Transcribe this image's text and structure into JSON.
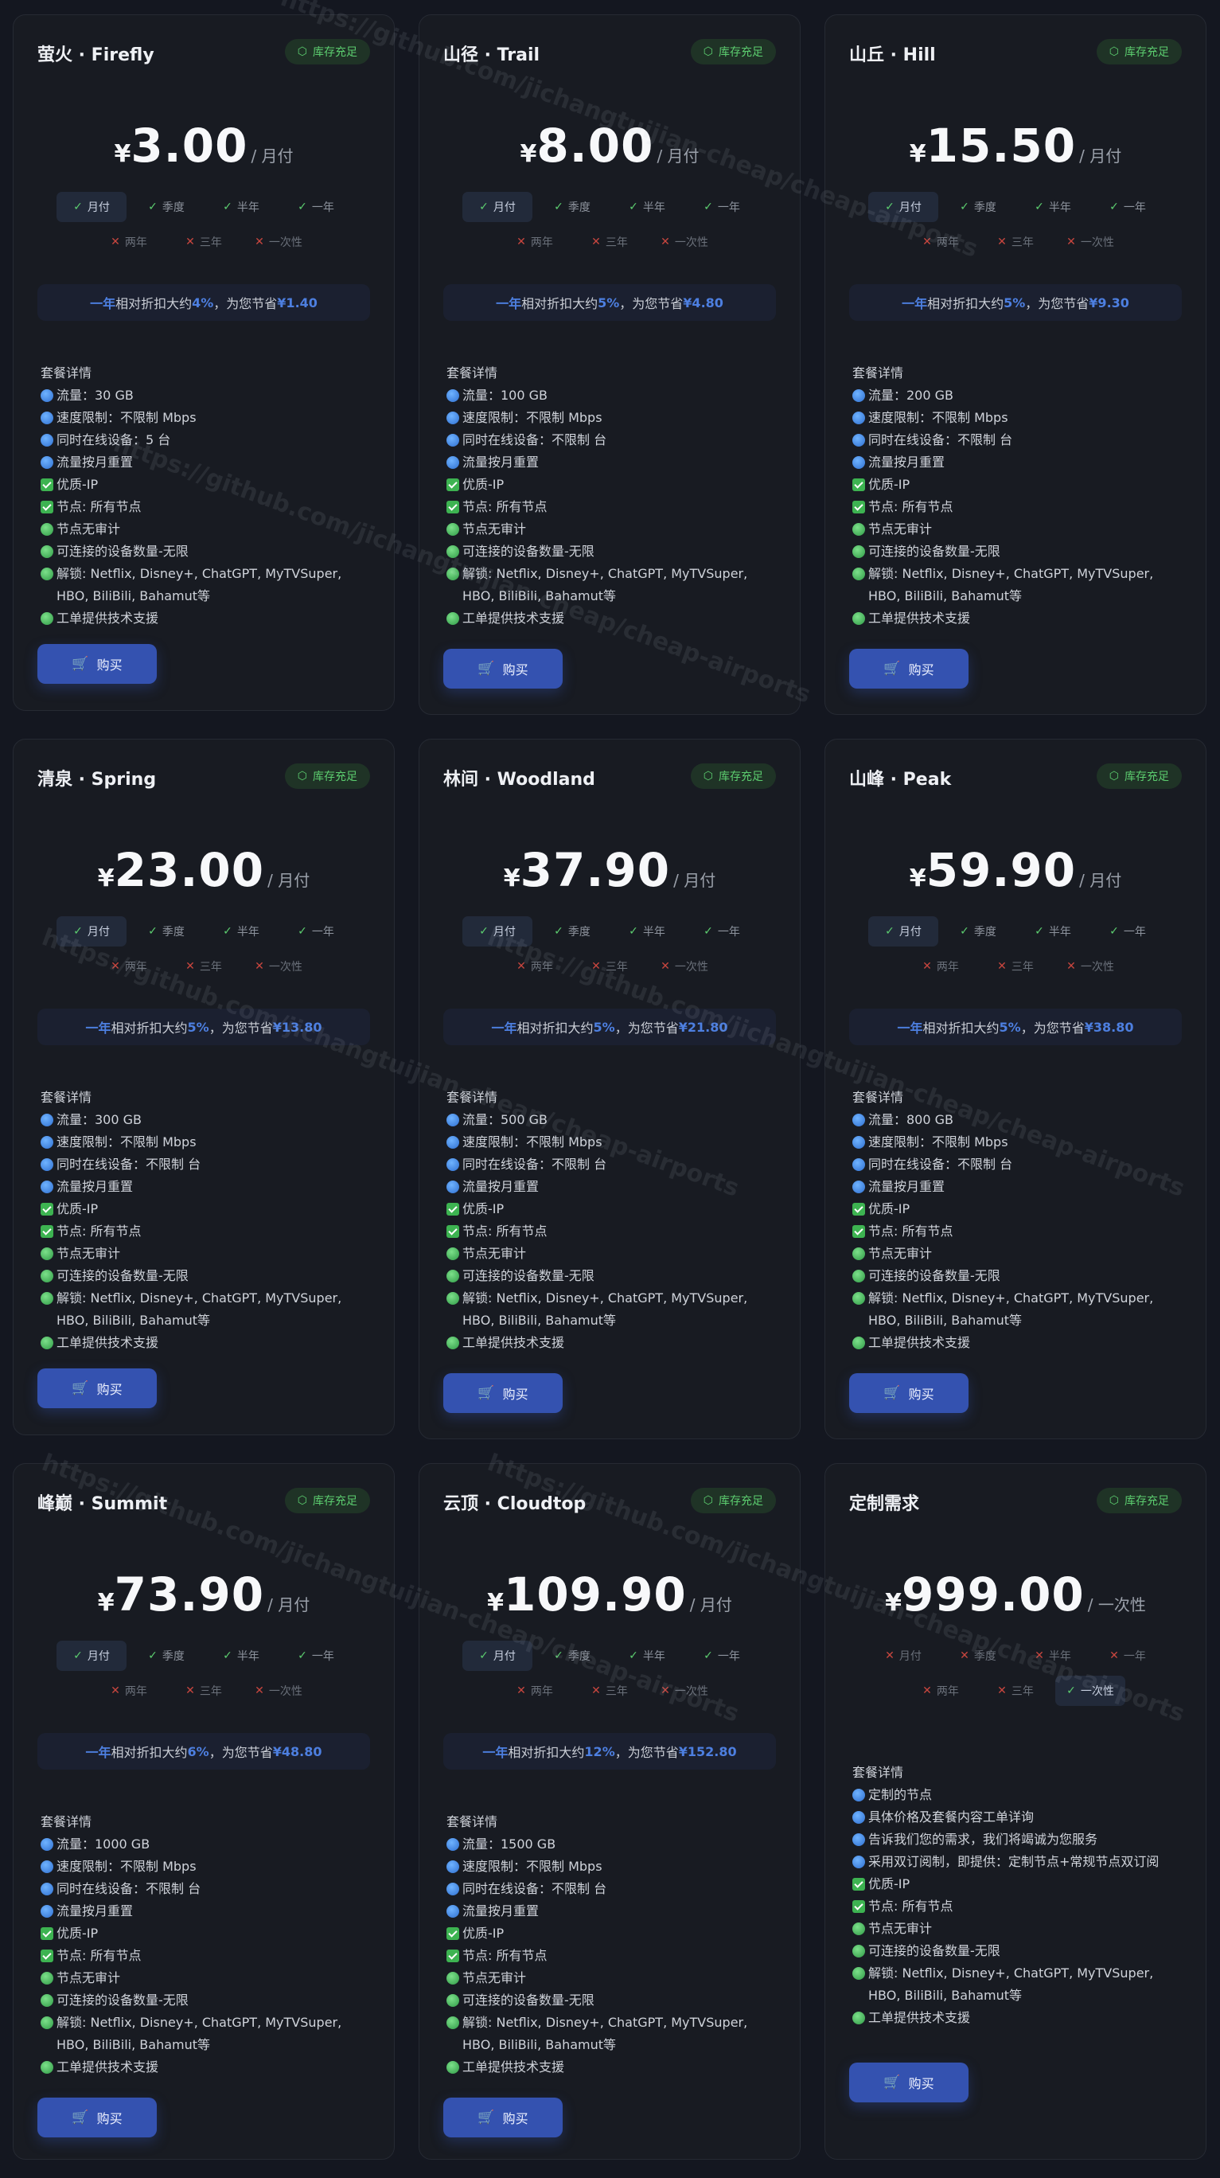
{
  "stock_label": "库存充足",
  "buy_label": "购买",
  "details_title": "套餐详情",
  "periods": {
    "month": "月付",
    "quarter": "季度",
    "half": "半年",
    "year": "一年",
    "two": "两年",
    "three": "三年",
    "once": "一次性"
  },
  "watermark": "https://github.com/jichangtuijian-cheap/cheap-airports",
  "discount": {
    "label": "一年",
    "mid": " 相对折扣大约 ",
    "save": "，为您节省 "
  },
  "plans": [
    {
      "name": "萤火 · Firefly",
      "currency": "¥",
      "price": "3.00",
      "per": "/ 月付",
      "discount_pct": "4%",
      "discount_amt": "¥1.40",
      "features": [
        "流量：30 GB",
        "速度限制：不限制 Mbps",
        "同时在线设备：5 台",
        "流量按月重置",
        "优质-IP",
        "节点: 所有节点",
        "节点无审计",
        "可连接的设备数量-无限",
        "解锁: Netflix, Disney+, ChatGPT, MyTVSuper, HBO, BiliBili, Bahamut等",
        "工单提供技术支援"
      ]
    },
    {
      "name": "山径 · Trail",
      "currency": "¥",
      "price": "8.00",
      "per": "/ 月付",
      "discount_pct": "5%",
      "discount_amt": "¥4.80",
      "features": [
        "流量：100 GB",
        "速度限制：不限制 Mbps",
        "同时在线设备：不限制 台",
        "流量按月重置",
        "优质-IP",
        "节点: 所有节点",
        "节点无审计",
        "可连接的设备数量-无限",
        "解锁: Netflix, Disney+, ChatGPT, MyTVSuper, HBO, BiliBili, Bahamut等",
        "工单提供技术支援"
      ]
    },
    {
      "name": "山丘 · Hill",
      "currency": "¥",
      "price": "15.50",
      "per": "/ 月付",
      "discount_pct": "5%",
      "discount_amt": "¥9.30",
      "features": [
        "流量：200 GB",
        "速度限制：不限制 Mbps",
        "同时在线设备：不限制 台",
        "流量按月重置",
        "优质-IP",
        "节点: 所有节点",
        "节点无审计",
        "可连接的设备数量-无限",
        "解锁: Netflix, Disney+, ChatGPT, MyTVSuper, HBO, BiliBili, Bahamut等",
        "工单提供技术支援"
      ]
    },
    {
      "name": "清泉 · Spring",
      "currency": "¥",
      "price": "23.00",
      "per": "/ 月付",
      "discount_pct": "5%",
      "discount_amt": "¥13.80",
      "features": [
        "流量：300 GB",
        "速度限制：不限制 Mbps",
        "同时在线设备：不限制 台",
        "流量按月重置",
        "优质-IP",
        "节点: 所有节点",
        "节点无审计",
        "可连接的设备数量-无限",
        "解锁: Netflix, Disney+, ChatGPT, MyTVSuper, HBO, BiliBili, Bahamut等",
        "工单提供技术支援"
      ]
    },
    {
      "name": "林间 · Woodland",
      "currency": "¥",
      "price": "37.90",
      "per": "/ 月付",
      "discount_pct": "5%",
      "discount_amt": "¥21.80",
      "features": [
        "流量：500 GB",
        "速度限制：不限制 Mbps",
        "同时在线设备：不限制 台",
        "流量按月重置",
        "优质-IP",
        "节点: 所有节点",
        "节点无审计",
        "可连接的设备数量-无限",
        "解锁: Netflix, Disney+, ChatGPT, MyTVSuper, HBO, BiliBili, Bahamut等",
        "工单提供技术支援"
      ]
    },
    {
      "name": "山峰 · Peak",
      "currency": "¥",
      "price": "59.90",
      "per": "/ 月付",
      "discount_pct": "5%",
      "discount_amt": "¥38.80",
      "features": [
        "流量：800 GB",
        "速度限制：不限制 Mbps",
        "同时在线设备：不限制 台",
        "流量按月重置",
        "优质-IP",
        "节点: 所有节点",
        "节点无审计",
        "可连接的设备数量-无限",
        "解锁: Netflix, Disney+, ChatGPT, MyTVSuper, HBO, BiliBili, Bahamut等",
        "工单提供技术支援"
      ]
    },
    {
      "name": "峰巅 · Summit",
      "currency": "¥",
      "price": "73.90",
      "per": "/ 月付",
      "discount_pct": "6%",
      "discount_amt": "¥48.80",
      "features": [
        "流量：1000 GB",
        "速度限制：不限制 Mbps",
        "同时在线设备：不限制 台",
        "流量按月重置",
        "优质-IP",
        "节点: 所有节点",
        "节点无审计",
        "可连接的设备数量-无限",
        "解锁: Netflix, Disney+, ChatGPT, MyTVSuper, HBO, BiliBili, Bahamut等",
        "工单提供技术支援"
      ]
    },
    {
      "name": "云顶 · Cloudtop",
      "currency": "¥",
      "price": "109.90",
      "per": "/ 月付",
      "discount_pct": "12%",
      "discount_amt": "¥152.80",
      "features": [
        "流量：1500 GB",
        "速度限制：不限制 Mbps",
        "同时在线设备：不限制 台",
        "流量按月重置",
        "优质-IP",
        "节点: 所有节点",
        "节点无审计",
        "可连接的设备数量-无限",
        "解锁: Netflix, Disney+, ChatGPT, MyTVSuper, HBO, BiliBili, Bahamut等",
        "工单提供技术支援"
      ]
    },
    {
      "name": "定制需求",
      "currency": "¥",
      "price": "999.00",
      "per": "/ 一次性",
      "discount_pct": "",
      "discount_amt": "",
      "features": [
        "定制的节点",
        "具体价格及套餐内容工单详询",
        "告诉我们您的需求，我们将竭诚为您服务",
        "采用双订阅制，即提供：定制节点+常规节点双订阅",
        "优质-IP",
        "节点: 所有节点",
        "节点无审计",
        "可连接的设备数量-无限",
        "解锁: Netflix, Disney+, ChatGPT, MyTVSuper, HBO, BiliBili, Bahamut等",
        "工单提供技术支援"
      ]
    }
  ],
  "icons": {
    "stock": "cube-icon",
    "cart": "cart-icon",
    "feature_globe": "globe-icon",
    "feature_check": "check-box-icon",
    "feature_dot": "green-dot-icon",
    "available": "check-icon",
    "unavailable": "cross-icon"
  },
  "colors": {
    "accent": "#3452b0",
    "stock_green": "#5ccd6f",
    "unavailable_red": "#c8463f",
    "highlight_blue": "#4d7fe0"
  }
}
